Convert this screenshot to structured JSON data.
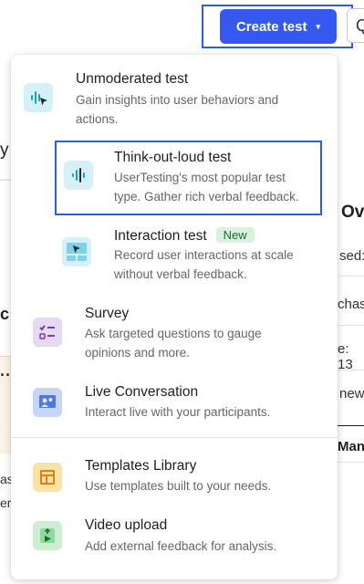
{
  "header": {
    "create_test_label": "Create test",
    "caret": "▾",
    "side_button_glyph": "Q"
  },
  "background": {
    "y": "y",
    "ov": "Ov",
    "c": "c",
    "dots": "...",
    "sed": "sed:",
    "chase": "chase",
    "e13": "e: 13",
    "newa": "newa",
    "man": "Man",
    "as": "as",
    "er": "er"
  },
  "menu": {
    "unmoderated": {
      "title": "Unmoderated test",
      "desc": "Gain insights into user behaviors and actions."
    },
    "think_out_loud": {
      "title": "Think-out-loud test",
      "desc": "UserTesting's most popular test type. Gather rich verbal feedback."
    },
    "interaction": {
      "title": "Interaction test",
      "badge": "New",
      "desc": "Record user interactions at scale without verbal feedback."
    },
    "survey": {
      "title": "Survey",
      "desc": "Ask targeted questions to gauge opinions and more."
    },
    "live_conversation": {
      "title": "Live Conversation",
      "desc": "Interact live with your participants."
    },
    "templates_library": {
      "title": "Templates Library",
      "desc": "Use templates built to your needs."
    },
    "video_upload": {
      "title": "Video upload",
      "desc": "Add external feedback for analysis."
    }
  },
  "colors": {
    "accent": "#3558f0",
    "highlight_border": "#2f5bea",
    "badge_bg": "#d9f2dd",
    "badge_text": "#1d6b2f"
  },
  "icons": {
    "unmoderated": "soundwave-cursor-icon",
    "think_out_loud": "soundwave-icon",
    "interaction": "screen-cursor-icon",
    "survey": "checklist-icon",
    "live_conversation": "people-icon",
    "templates_library": "layout-icon",
    "video_upload": "video-upload-icon"
  }
}
